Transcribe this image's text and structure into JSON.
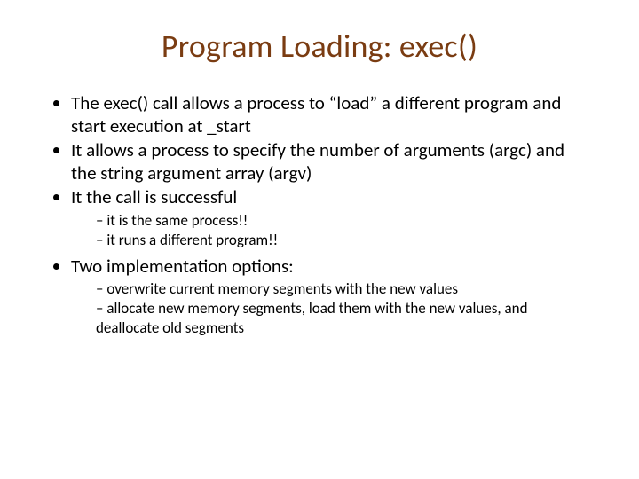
{
  "title": "Program Loading: exec()",
  "bullets": {
    "b1": "The exec() call allows a process to “load” a different program and start execution at _start",
    "b2": "It allows a process to specify the number of arguments (argc) and the string argument array (argv)",
    "b3": "It the call is successful",
    "b3_sub1": "it is the same process!!",
    "b3_sub2": "it runs a different program!!",
    "b4": "Two implementation options:",
    "b4_sub1": "overwrite current memory segments with the new values",
    "b4_sub2": "allocate new memory segments, load them with the new values, and deallocate old segments"
  }
}
